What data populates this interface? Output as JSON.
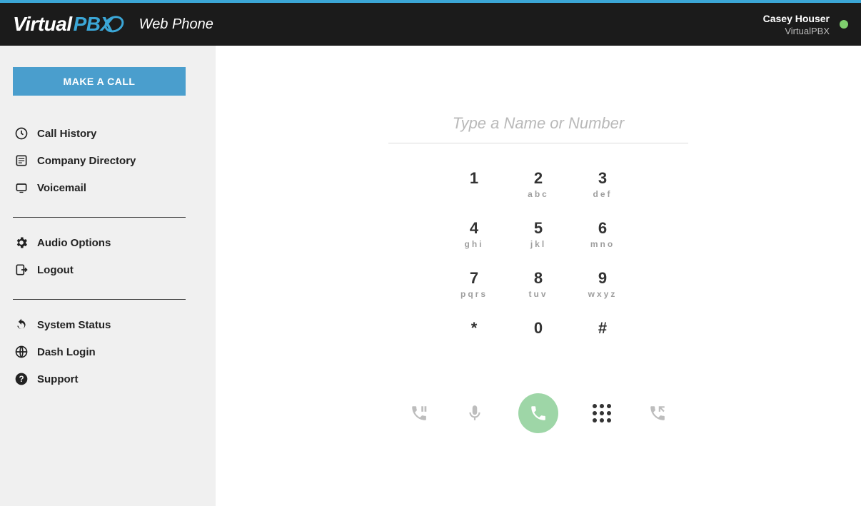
{
  "header": {
    "logo_virtual": "Virtual",
    "logo_pbx": "PBX",
    "app_title": "Web Phone",
    "user_name": "Casey Houser",
    "org_name": "VirtualPBX"
  },
  "sidebar": {
    "make_call_label": "MAKE A CALL",
    "group1": [
      {
        "label": "Call History"
      },
      {
        "label": "Company Directory"
      },
      {
        "label": "Voicemail"
      }
    ],
    "group2": [
      {
        "label": "Audio Options"
      },
      {
        "label": "Logout"
      }
    ],
    "group3": [
      {
        "label": "System Status"
      },
      {
        "label": "Dash Login"
      },
      {
        "label": "Support"
      }
    ]
  },
  "dialer": {
    "input_placeholder": "Type a Name or Number",
    "keys": [
      {
        "digit": "1",
        "letters": ""
      },
      {
        "digit": "2",
        "letters": "abc"
      },
      {
        "digit": "3",
        "letters": "def"
      },
      {
        "digit": "4",
        "letters": "ghi"
      },
      {
        "digit": "5",
        "letters": "jkl"
      },
      {
        "digit": "6",
        "letters": "mno"
      },
      {
        "digit": "7",
        "letters": "pqrs"
      },
      {
        "digit": "8",
        "letters": "tuv"
      },
      {
        "digit": "9",
        "letters": "wxyz"
      },
      {
        "digit": "*",
        "letters": ""
      },
      {
        "digit": "0",
        "letters": ""
      },
      {
        "digit": "#",
        "letters": ""
      }
    ]
  },
  "colors": {
    "accent": "#3ba6d6",
    "sidebar_bg": "#f0f0f0",
    "call_green": "#9ed6a7",
    "presence_green": "#7fcf6e"
  }
}
